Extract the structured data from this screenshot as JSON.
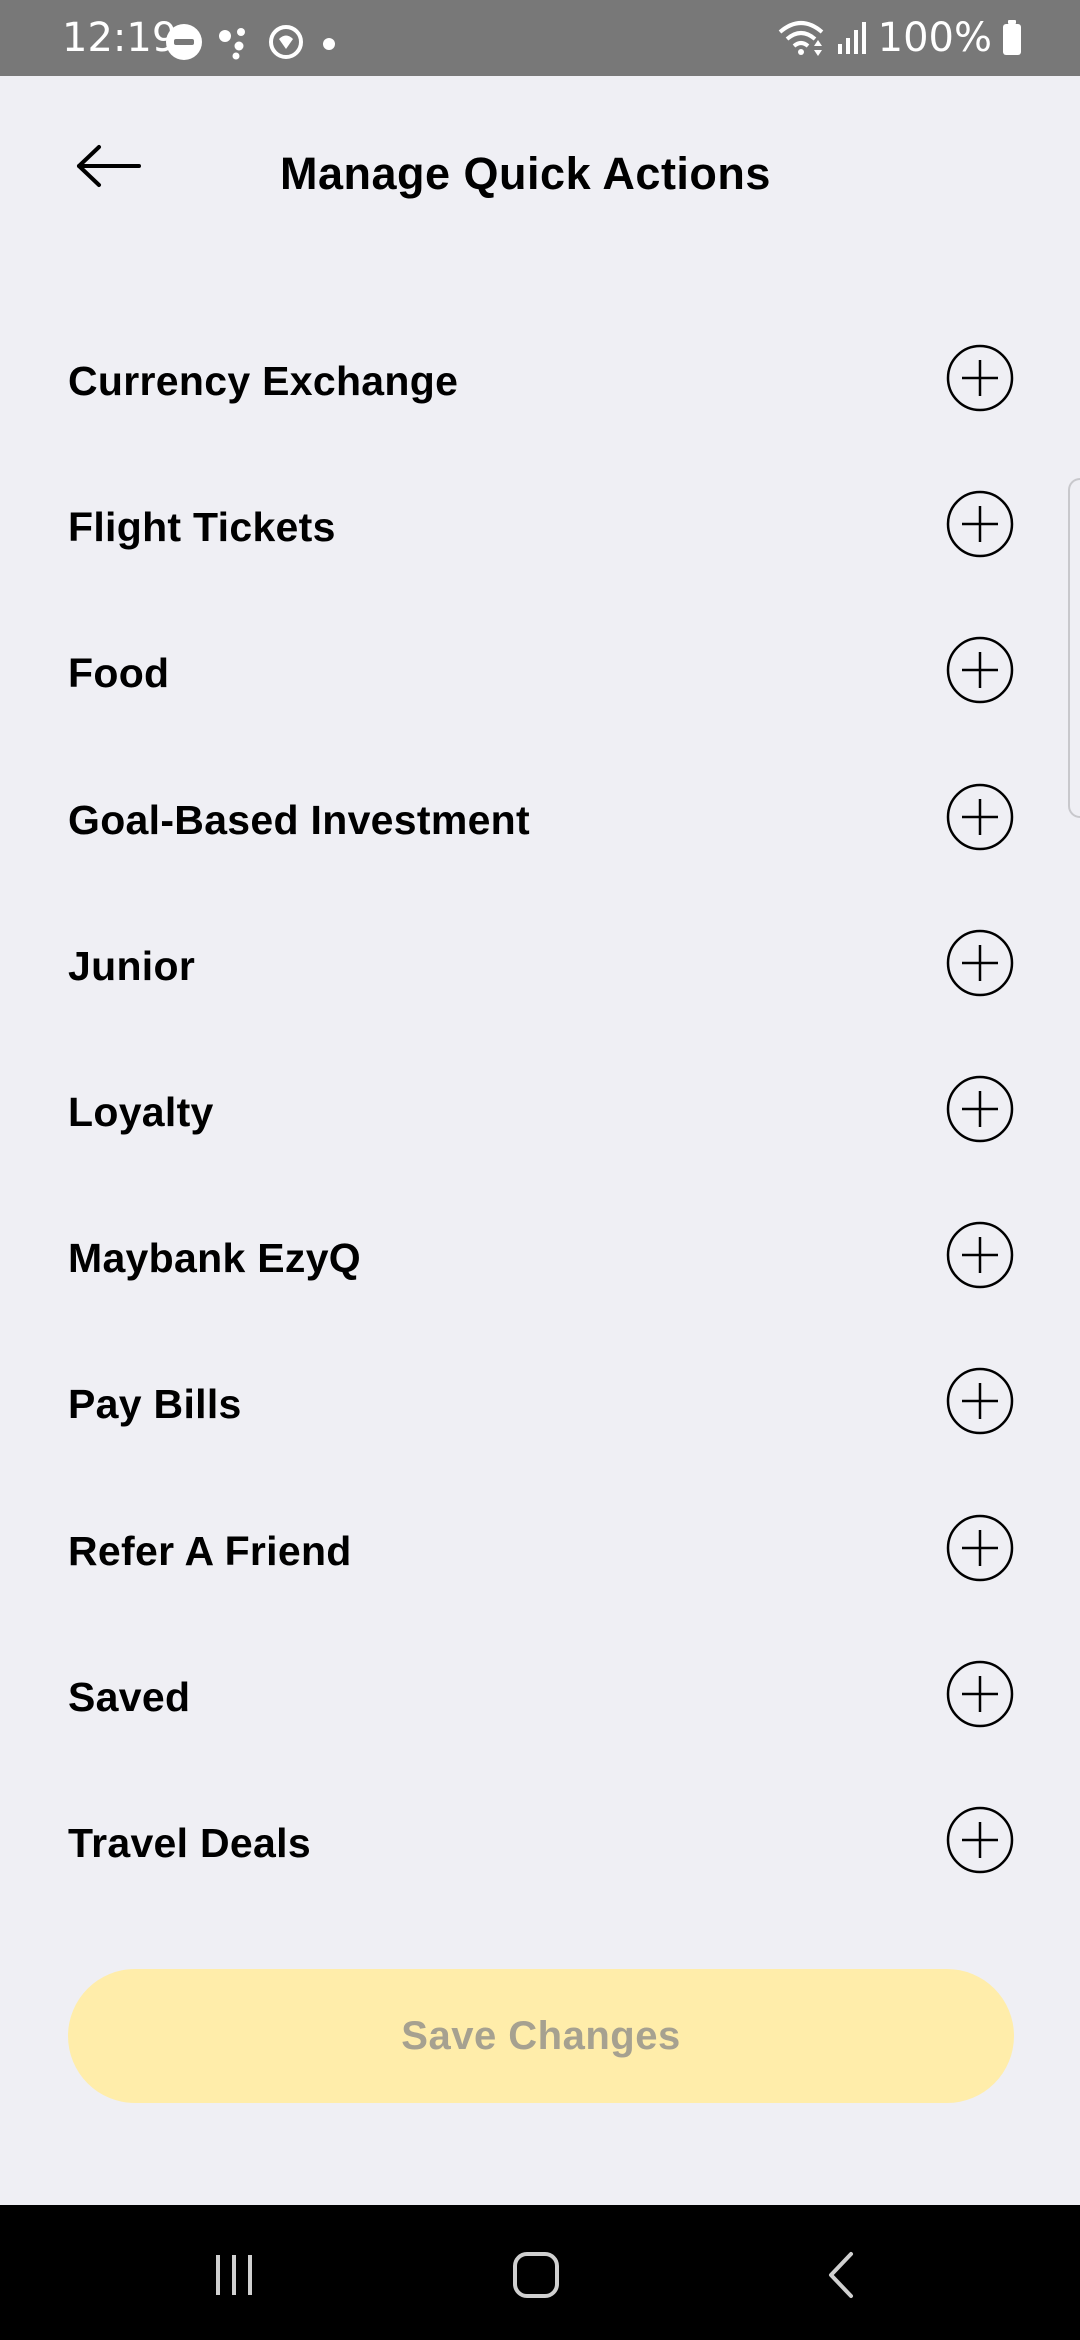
{
  "status_bar": {
    "time": "12:19",
    "battery": "100%",
    "icons": [
      "do-not-disturb-icon",
      "assistant-dots-icon",
      "smart-life-icon",
      "notification-dot-icon",
      "wifi-icon",
      "signal-icon",
      "battery-icon"
    ]
  },
  "header": {
    "title": "Manage Quick Actions",
    "back_icon": "arrow-left-icon"
  },
  "actions": [
    {
      "label": "Currency Exchange"
    },
    {
      "label": "Flight Tickets"
    },
    {
      "label": "Food"
    },
    {
      "label": "Goal-Based Investment"
    },
    {
      "label": "Junior"
    },
    {
      "label": "Loyalty"
    },
    {
      "label": "Maybank EzyQ"
    },
    {
      "label": "Pay Bills"
    },
    {
      "label": "Refer A Friend"
    },
    {
      "label": "Saved"
    },
    {
      "label": "Travel Deals"
    }
  ],
  "add_icon": "plus-circle-icon",
  "save_button": {
    "label": "Save Changes",
    "background": "#ffedaa",
    "text_color": "#a6a190",
    "enabled": false
  },
  "nav_bar": {
    "icons": [
      "recent-apps-icon",
      "home-icon",
      "back-icon"
    ]
  },
  "colors": {
    "page_background": "#efeff4",
    "status_bar": "#787878",
    "nav_bar": "#000000"
  }
}
